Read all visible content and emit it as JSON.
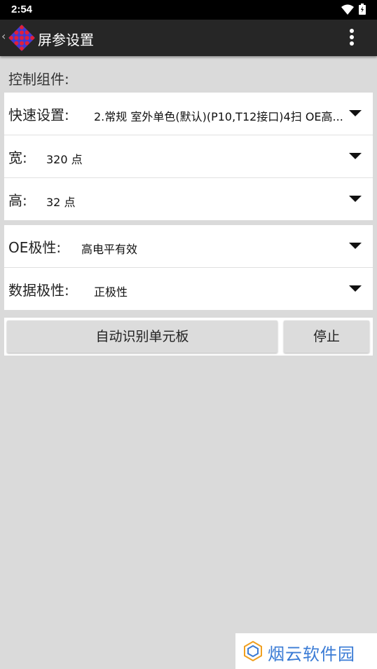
{
  "status_bar": {
    "time": "2:54"
  },
  "app_bar": {
    "back_glyph": "‹",
    "title": "屏参设置",
    "overflow_icon": "more-vert-icon"
  },
  "section": {
    "label": "控制组件:"
  },
  "settings": {
    "quick": {
      "label": "快速设置:",
      "value": "2.常规 室外单色(默认)(P10,T12接口)4扫 OE高..."
    },
    "width": {
      "label": "宽:",
      "value": "320 点"
    },
    "height": {
      "label": "高:",
      "value": "32 点"
    },
    "oe": {
      "label": "OE极性:",
      "value": "高电平有效"
    },
    "data": {
      "label": "数据极性:",
      "value": "正极性"
    }
  },
  "buttons": {
    "auto_detect": "自动识别单元板",
    "stop": "停止"
  },
  "watermark": {
    "text": "烟云软件园"
  },
  "colors": {
    "accent": "#3a7bd5",
    "appbar": "#262626",
    "background": "#dadada"
  }
}
